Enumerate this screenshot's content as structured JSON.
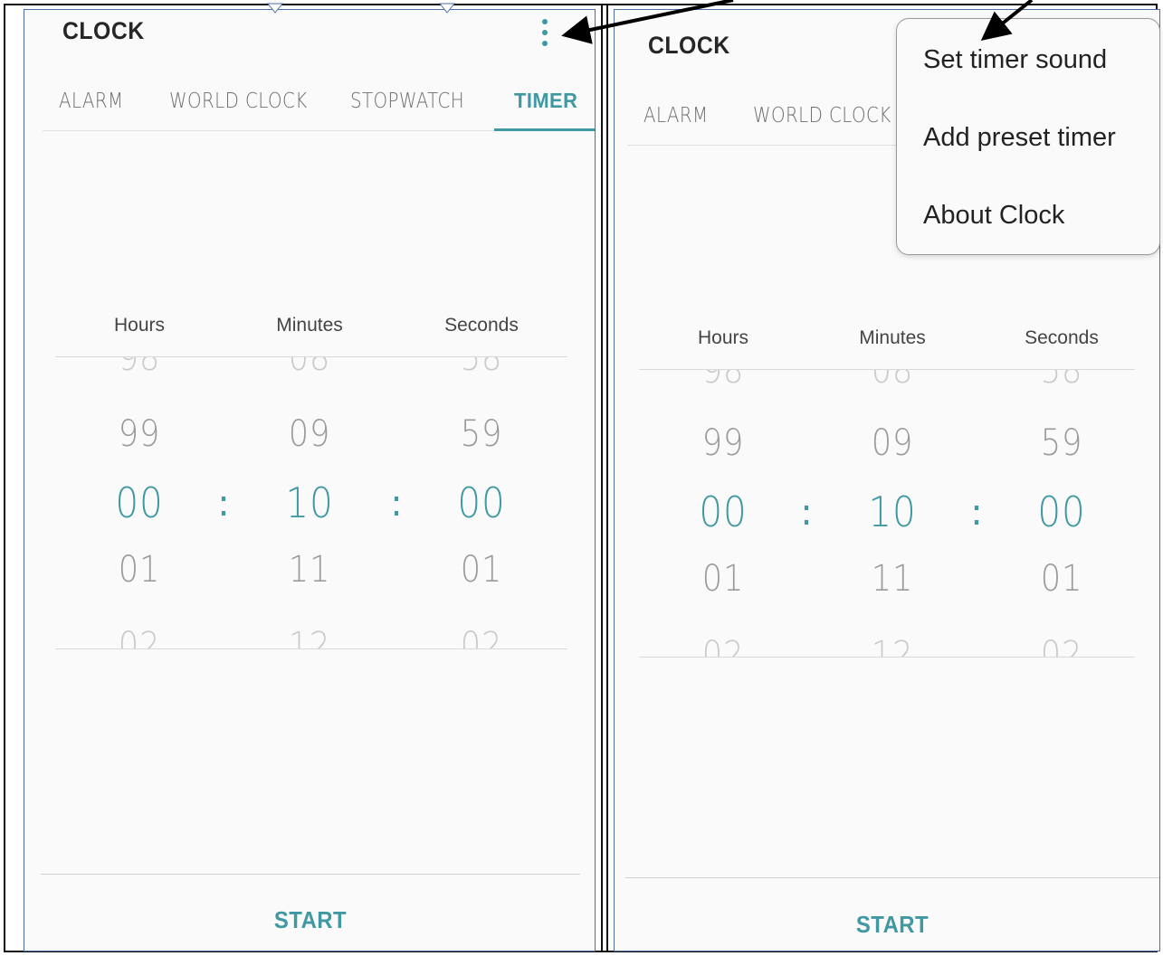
{
  "app": {
    "title": "CLOCK"
  },
  "tabs": [
    {
      "label": "ALARM"
    },
    {
      "label": "WORLD CLOCK"
    },
    {
      "label": "STOPWATCH"
    },
    {
      "label": "TIMER",
      "active": true
    }
  ],
  "timer": {
    "labels": {
      "hours": "Hours",
      "minutes": "Minutes",
      "seconds": "Seconds"
    },
    "hours": {
      "prev2": "98",
      "prev1": "99",
      "value": "00",
      "next1": "01",
      "next2": "02"
    },
    "minutes": {
      "prev2": "08",
      "prev1": "09",
      "value": "10",
      "next1": "11",
      "next2": "12"
    },
    "seconds": {
      "prev2": "58",
      "prev1": "59",
      "value": "00",
      "next1": "01",
      "next2": "02"
    },
    "separator": ":"
  },
  "start_label": "START",
  "more_menu": {
    "icon": "more-vertical-icon",
    "items": [
      {
        "label": "Set timer sound"
      },
      {
        "label": "Add preset timer"
      },
      {
        "label": "About Clock"
      }
    ]
  },
  "colors": {
    "accent": "#3f98a2",
    "background": "#fafafa",
    "panel_border": "#4a6fa5"
  }
}
